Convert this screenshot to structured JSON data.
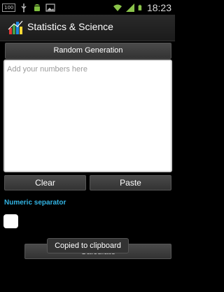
{
  "status_bar": {
    "battery_badge": "100",
    "time": "18:23",
    "icons": [
      "usb-icon",
      "android-icon",
      "image-icon",
      "wifi-icon",
      "signal-icon",
      "battery-icon"
    ]
  },
  "app": {
    "title": "Statistics & Science",
    "icon": "app-icon"
  },
  "controls": {
    "random_generation_label": "Random Generation",
    "input_placeholder": "Add your numbers here",
    "clear_label": "Clear",
    "paste_label": "Paste",
    "numeric_separator_label": "Numeric separator",
    "calculate_label": "Calculate"
  },
  "toast": {
    "message": "Copied to clipboard"
  },
  "colors": {
    "accent": "#33b5e5",
    "background": "#000000"
  }
}
